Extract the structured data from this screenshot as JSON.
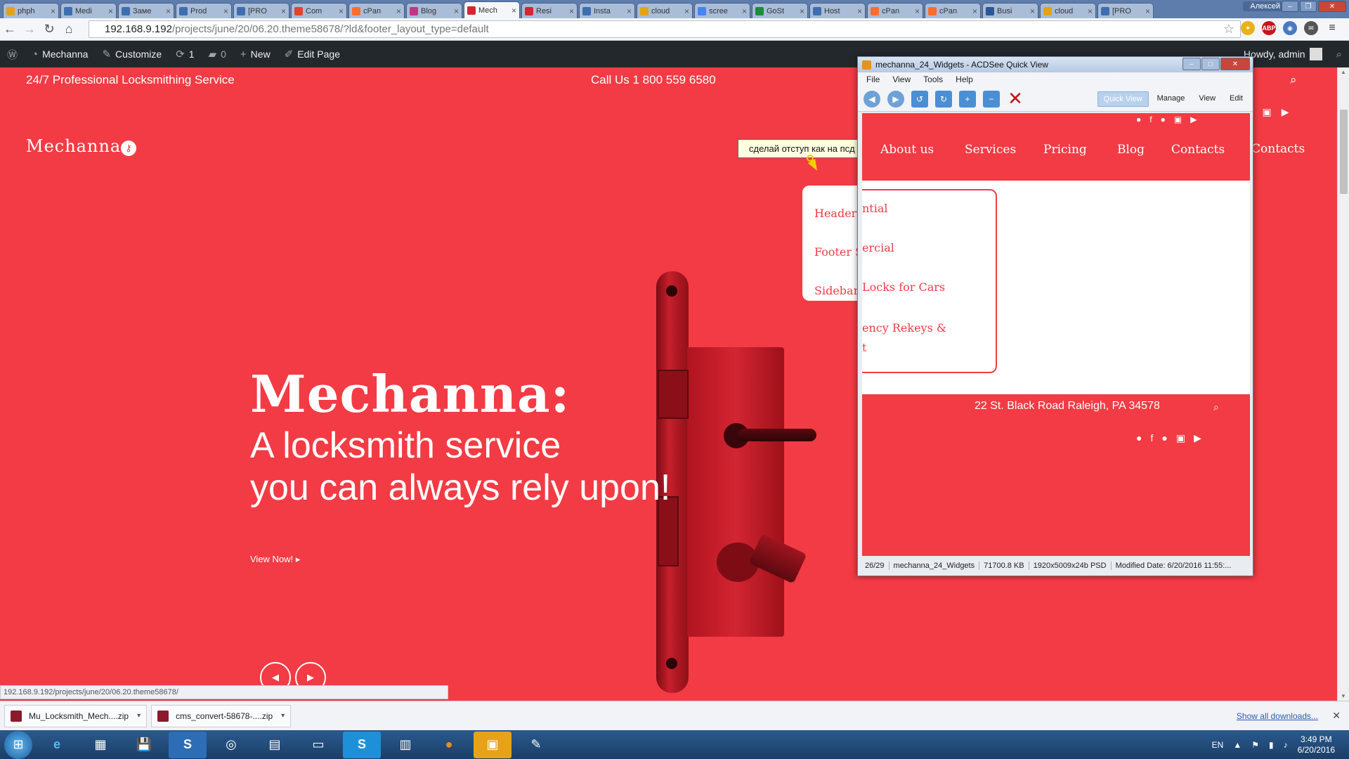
{
  "browser": {
    "tabs": [
      {
        "label": "phph",
        "color": "#e3a21a"
      },
      {
        "label": "Medi",
        "color": "#3d6fb0"
      },
      {
        "label": "Заме",
        "color": "#3d6fb0"
      },
      {
        "label": "Prod",
        "color": "#3d6fb0"
      },
      {
        "label": "[PRO",
        "color": "#3d6fb0"
      },
      {
        "label": "Com",
        "color": "#e24329"
      },
      {
        "label": "cPan",
        "color": "#ff6c2c"
      },
      {
        "label": "Blog",
        "color": "#c13584"
      },
      {
        "label": "Mech",
        "color": "#d7262f"
      },
      {
        "label": "Resi",
        "color": "#d7262f"
      },
      {
        "label": "Insta",
        "color": "#3d6fb0"
      },
      {
        "label": "cloud",
        "color": "#e3a21a"
      },
      {
        "label": "scree",
        "color": "#4285f4"
      },
      {
        "label": "GoSt",
        "color": "#1a8c3a"
      },
      {
        "label": "Host",
        "color": "#3d6fb0"
      },
      {
        "label": "cPan",
        "color": "#ff6c2c"
      },
      {
        "label": "cPan",
        "color": "#ff6c2c"
      },
      {
        "label": "Busi",
        "color": "#2b5797"
      },
      {
        "label": "cloud",
        "color": "#e3a21a"
      },
      {
        "label": "[PRO",
        "color": "#3d6fb0"
      }
    ],
    "active_tab_index": 8,
    "user_badge": "Алексей",
    "url_host": "192.168.9.192",
    "url_path": "/projects/june/20/06.20.theme58678/?ld&footer_layout_type=default",
    "status_url": "192.168.9.192/projects/june/20/06.20.theme58678/",
    "ext_abp": "ABP"
  },
  "wp_admin_bar": {
    "site_name": "Mechanna",
    "customize": "Customize",
    "updates_count": "1",
    "comments_count": "0",
    "new_label": "New",
    "edit_page": "Edit Page",
    "howdy": "Howdy, admin"
  },
  "site": {
    "tagline": "24/7 Professional Locksmithing Service",
    "call_us": "Call Us 1 800 559 6580",
    "logo": "Mechanna",
    "nav_contacts": "Contacts",
    "submenu": [
      "Header",
      "Footer S",
      "Sidebar"
    ],
    "hero_title": "Mechanna:",
    "hero_line1": "A locksmith service",
    "hero_line2": "you can always rely upon!",
    "view_now": "View Now!",
    "brand_color": "#f23b44"
  },
  "tooltip": "сделай отступ как на псд",
  "acdsee": {
    "title": "mechanna_24_Widgets - ACDSee Quick View",
    "menu": [
      "File",
      "View",
      "Tools",
      "Help"
    ],
    "modes": [
      "Quick View",
      "Manage",
      "View",
      "Edit"
    ],
    "active_mode": "Quick View",
    "preview": {
      "nav": [
        "About us",
        "Services",
        "Pricing",
        "Blog",
        "Contacts"
      ],
      "dropdown": [
        "ntial",
        "ercial",
        "Locks for Cars",
        "ency Rekeys &",
        "t"
      ],
      "address": "22 St. Black Road  Raleigh, PA 34578"
    },
    "status": [
      "26/29",
      "mechanna_24_Widgets",
      "71700.8 KB",
      "1920x5009x24b PSD",
      "Modified Date: 6/20/2016 11:55:..."
    ]
  },
  "downloads": {
    "items": [
      "Mu_Locksmith_Mech....zip",
      "cms_convert-58678-....zip"
    ],
    "show_all": "Show all downloads..."
  },
  "taskbar": {
    "lang": "EN",
    "time": "3:49 PM",
    "date": "6/20/2016"
  }
}
